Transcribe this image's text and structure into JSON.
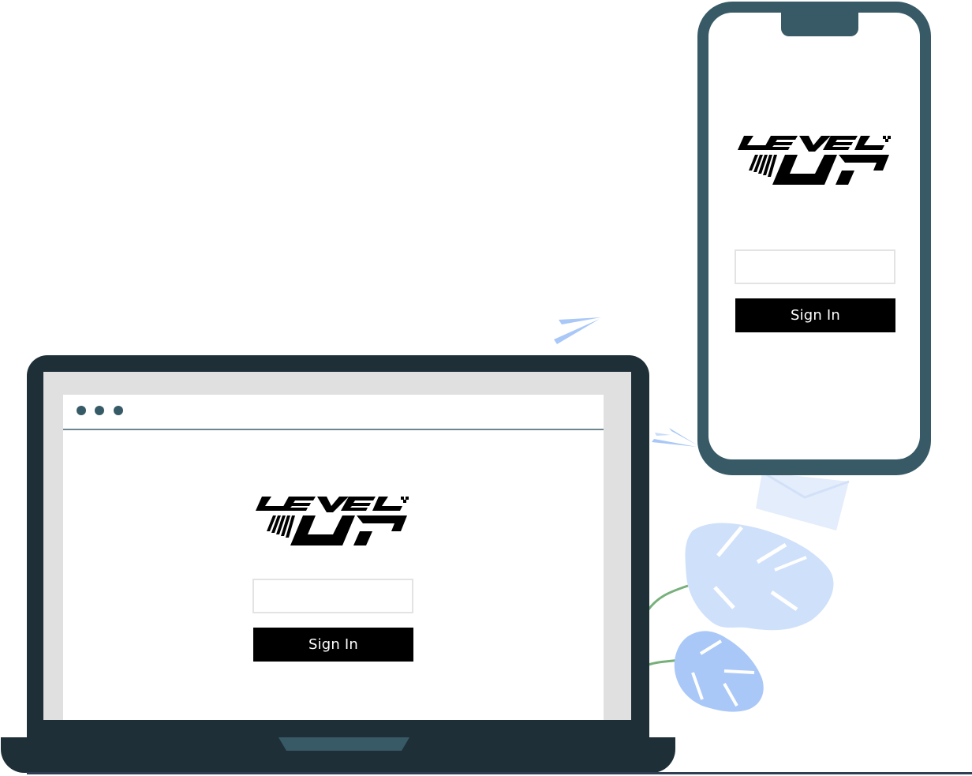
{
  "colors": {
    "frame_dark": "#1e2f37",
    "frame_teal": "#375a66",
    "button_bg": "#000000",
    "button_text": "#ffffff",
    "leaf_light": "#cfe0fa",
    "leaf_mid": "#a9c8f7",
    "stem_green": "#77b07a"
  },
  "brand": {
    "logo_icon": "level-up-logo"
  },
  "browser": {
    "controls": [
      "window-dot",
      "window-dot",
      "window-dot"
    ]
  },
  "laptop_login": {
    "input_placeholder": "",
    "sign_in_label": "Sign In"
  },
  "phone_login": {
    "input_placeholder": "",
    "sign_in_label": "Sign In"
  },
  "decorations": [
    "paper-plane",
    "envelope-icon",
    "monstera-leaf"
  ]
}
